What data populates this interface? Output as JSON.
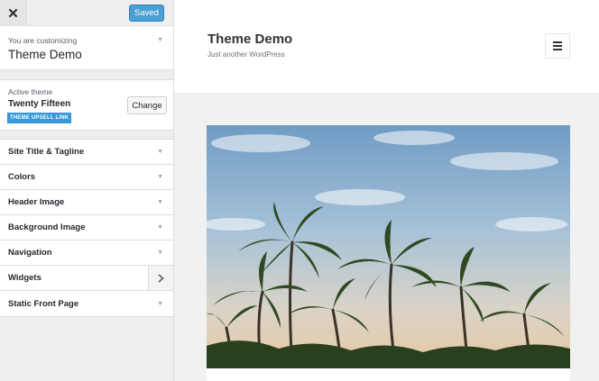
{
  "topbar": {
    "close_label": "✕",
    "saved_label": "Saved"
  },
  "customizing": {
    "label": "You are customizing",
    "title": "Theme Demo"
  },
  "active_theme": {
    "label": "Active theme",
    "name": "Twenty Fifteen",
    "upsell_badge": "THEME UPSELL LINK",
    "change_label": "Change"
  },
  "sections": [
    {
      "title": "Site Title & Tagline",
      "indicator": "caret-down-icon"
    },
    {
      "title": "Colors",
      "indicator": "caret-down-icon"
    },
    {
      "title": "Header Image",
      "indicator": "caret-down-icon"
    },
    {
      "title": "Background Image",
      "indicator": "caret-down-icon"
    },
    {
      "title": "Navigation",
      "indicator": "caret-down-icon"
    },
    {
      "title": "Widgets",
      "indicator": "chevron-right-icon"
    },
    {
      "title": "Static Front Page",
      "indicator": "caret-down-icon"
    }
  ],
  "preview": {
    "site_title": "Theme Demo",
    "tagline": "Just another WordPress"
  },
  "colors": {
    "accent": "#4a9fd3",
    "badge": "#3498db",
    "sidebar_bg": "#eeeeee"
  }
}
